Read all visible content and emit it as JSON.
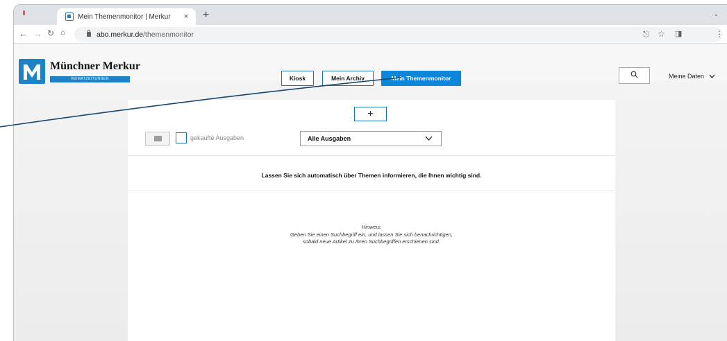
{
  "browser": {
    "tab_title": "Mein Themenmonitor | Merkur",
    "tab_close": "×",
    "new_tab": "+",
    "tab_menu": "⌄",
    "url_host": "abo.merkur.de",
    "url_path": "/themenmonitor"
  },
  "brand": {
    "name": "Münchner Merkur",
    "sub": "HEIMATZEITUNGEN",
    "color": "#1d82c6"
  },
  "nav": {
    "kiosk": "Kiosk",
    "archiv": "Mein Archiv",
    "themenmonitor": "Mein Themenmonitor",
    "meine_daten": "Meine Daten"
  },
  "content": {
    "add": "+",
    "checkbox_label": "gekaufte Ausgaben",
    "select_value": "Alle Ausgaben",
    "info": "Lassen Sie sich automatisch über Themen informieren, die Ihnen wichtig sind.",
    "hint_title": "Hinweis:",
    "hint_line1": "Geben Sie einen Suchbegriff ein, und lassen Sie sich benachrichtigen,",
    "hint_line2": "sobald neue Artikel zu Ihren Suchbegriffen erschienen sind."
  },
  "colors": {
    "primary": "#0c86d8",
    "outline": "#1d6fb3"
  }
}
